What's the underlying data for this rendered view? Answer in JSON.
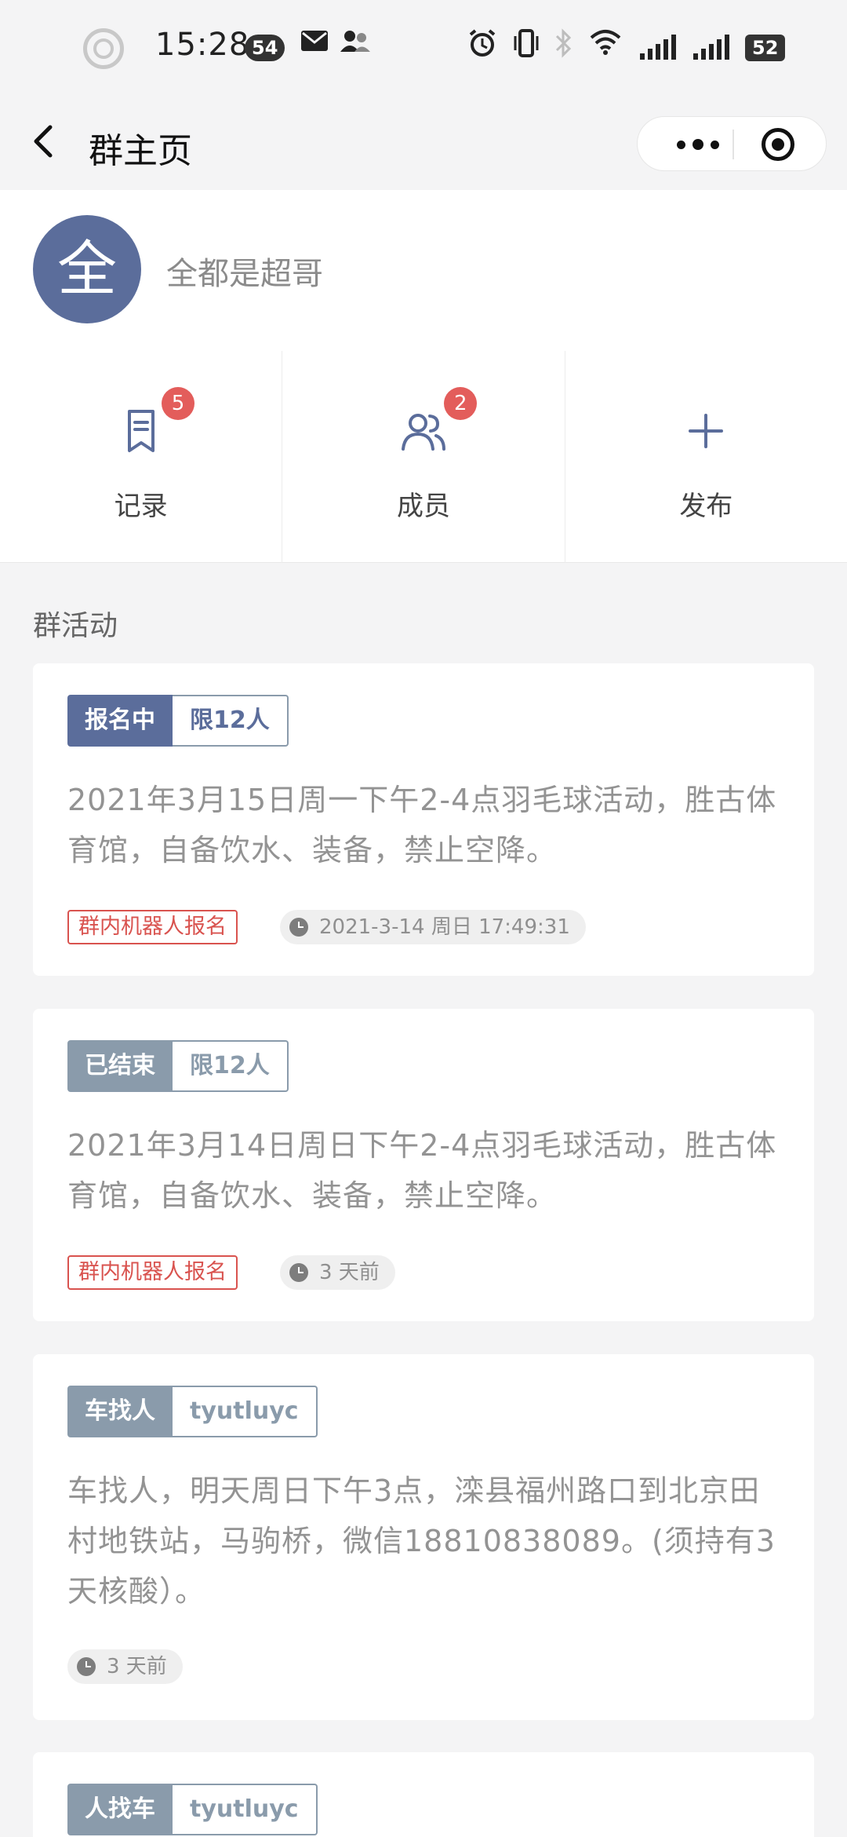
{
  "status_bar": {
    "time": "15:28",
    "notification_count": "54",
    "battery": "52",
    "icons": [
      "record-icon",
      "mail-icon",
      "contacts-icon",
      "alarm-icon",
      "vibrate-icon",
      "bluetooth-icon",
      "wifi-icon",
      "signal-icon",
      "signal-2-icon"
    ]
  },
  "nav": {
    "title": "群主页",
    "back_icon": "chevron-left-icon",
    "more_icon": "more-dots-icon",
    "close_icon": "target-icon"
  },
  "group": {
    "avatar_text": "全",
    "name": "全都是超哥",
    "avatar_color": "#5b6d9b"
  },
  "actions": [
    {
      "label": "记录",
      "badge": "5",
      "icon": "record-book-icon"
    },
    {
      "label": "成员",
      "badge": "2",
      "icon": "members-icon"
    },
    {
      "label": "发布",
      "badge": "",
      "icon": "plus-icon"
    }
  ],
  "section": {
    "title": "群活动"
  },
  "activities": [
    {
      "status": "报名中",
      "extra": "限12人",
      "text": "2021年3月15日周一下午2-4点羽毛球活动，胜古体育馆，自备饮水、装备，禁止空降。",
      "source": "群内机器人报名",
      "time": "2021-3-14 周日 17:49:31"
    },
    {
      "status": "已结束",
      "extra": "限12人",
      "text": "2021年3月14日周日下午2-4点羽毛球活动，胜古体育馆，自备饮水、装备，禁止空降。",
      "source": "群内机器人报名",
      "time": "3 天前"
    },
    {
      "status": "车找人",
      "extra": "tyutluyc",
      "text": "车找人，明天周日下午3点，滦县福州路口到北京田村地铁站，马驹桥，微信18810838089。(须持有3天核酸）。",
      "source": "",
      "time": "3 天前"
    },
    {
      "status": "人找车",
      "extra": "tyutluyc",
      "text": "",
      "source": "",
      "time": ""
    }
  ],
  "colors": {
    "accent": "#5b6d9b",
    "ended": "#8a9bab",
    "badge": "#e35d5b",
    "source_chip": "#d9534f"
  }
}
